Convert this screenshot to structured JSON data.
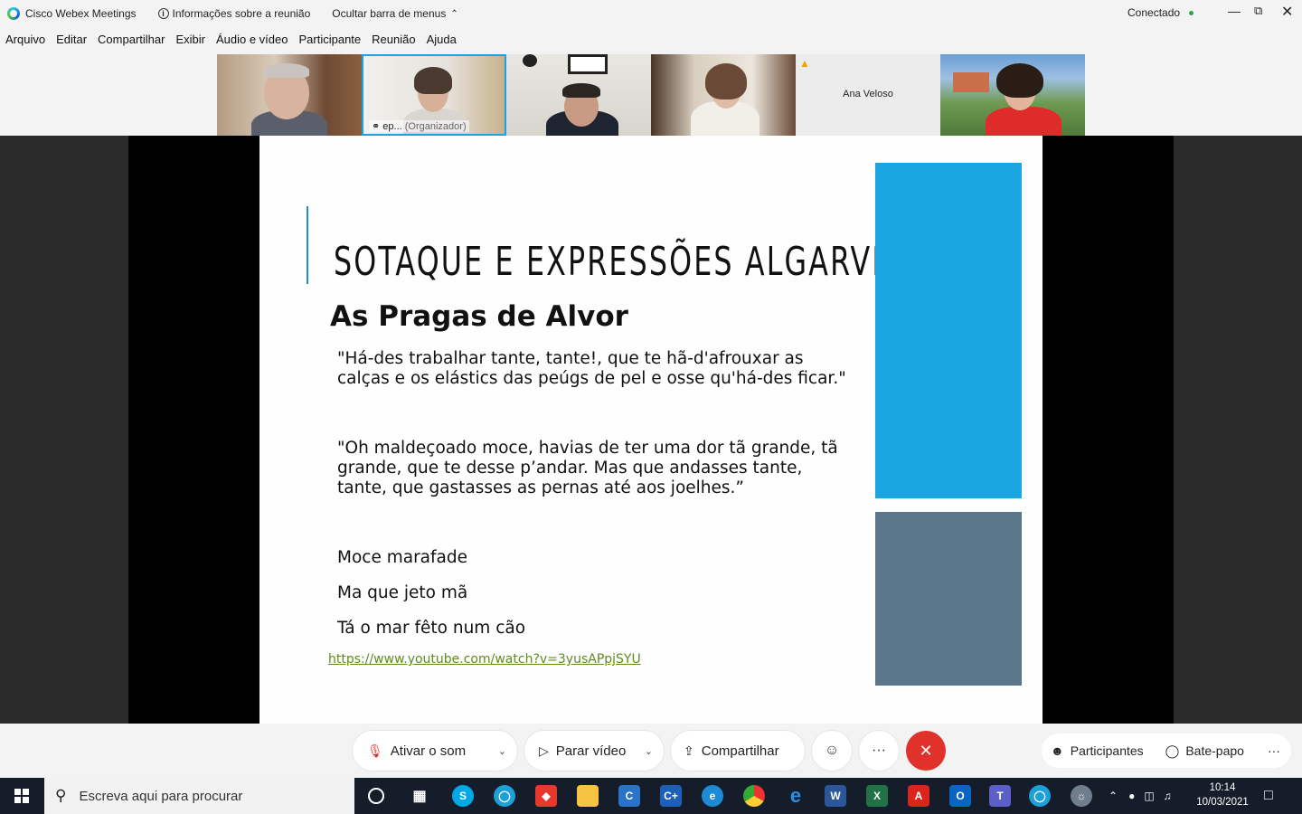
{
  "window": {
    "app_title": "Cisco Webex Meetings",
    "meeting_info": "Informações sobre a reunião",
    "hide_menu": "Ocultar barra de menus",
    "connection_status": "Conectado"
  },
  "menu": [
    "Arquivo",
    "Editar",
    "Compartilhar",
    "Exibir",
    "Áudio e vídeo",
    "Participante",
    "Reunião",
    "Ajuda"
  ],
  "participants": [
    {
      "name": ""
    },
    {
      "name": "ep...",
      "role": "(Organizador)"
    },
    {
      "name": ""
    },
    {
      "name": ""
    },
    {
      "name": "Ana Veloso"
    },
    {
      "name": ""
    }
  ],
  "slide": {
    "title": "SOTAQUE E EXPRESSÕES ALGARVIAS",
    "subtitle": "As Pragas de Alvor",
    "quote1": "\"Há-des trabalhar tante, tante!, que te hã-d'afrouxar as calças e os elástics das peúgs de pel e osse qu'há-des ficar.\"",
    "quote2": "\"Oh maldeçoado moce, havias de ter uma dor tã grande, tã grande, que te desse p’andar. Mas que andasses tante, tante, que gastasses as pernas até aos joelhes.”",
    "lines": [
      "Moce marafade",
      "Ma que jeto mã",
      "Tá o mar fêto num cão"
    ],
    "link": "https://www.youtube.com/watch?v=3yusAPpjSYU",
    "colors": {
      "blue_block": "#1aa7e1",
      "gray_block": "#5b778c",
      "link": "#5d8c1f"
    }
  },
  "controls": {
    "mute": "Ativar o som",
    "video": "Parar vídeo",
    "share": "Compartilhar",
    "participants": "Participantes",
    "chat": "Bate-papo",
    "end_color": "#e0322a"
  },
  "taskbar": {
    "search_placeholder": "Escreva aqui para procurar",
    "time": "10:14",
    "date": "10/03/2021"
  }
}
